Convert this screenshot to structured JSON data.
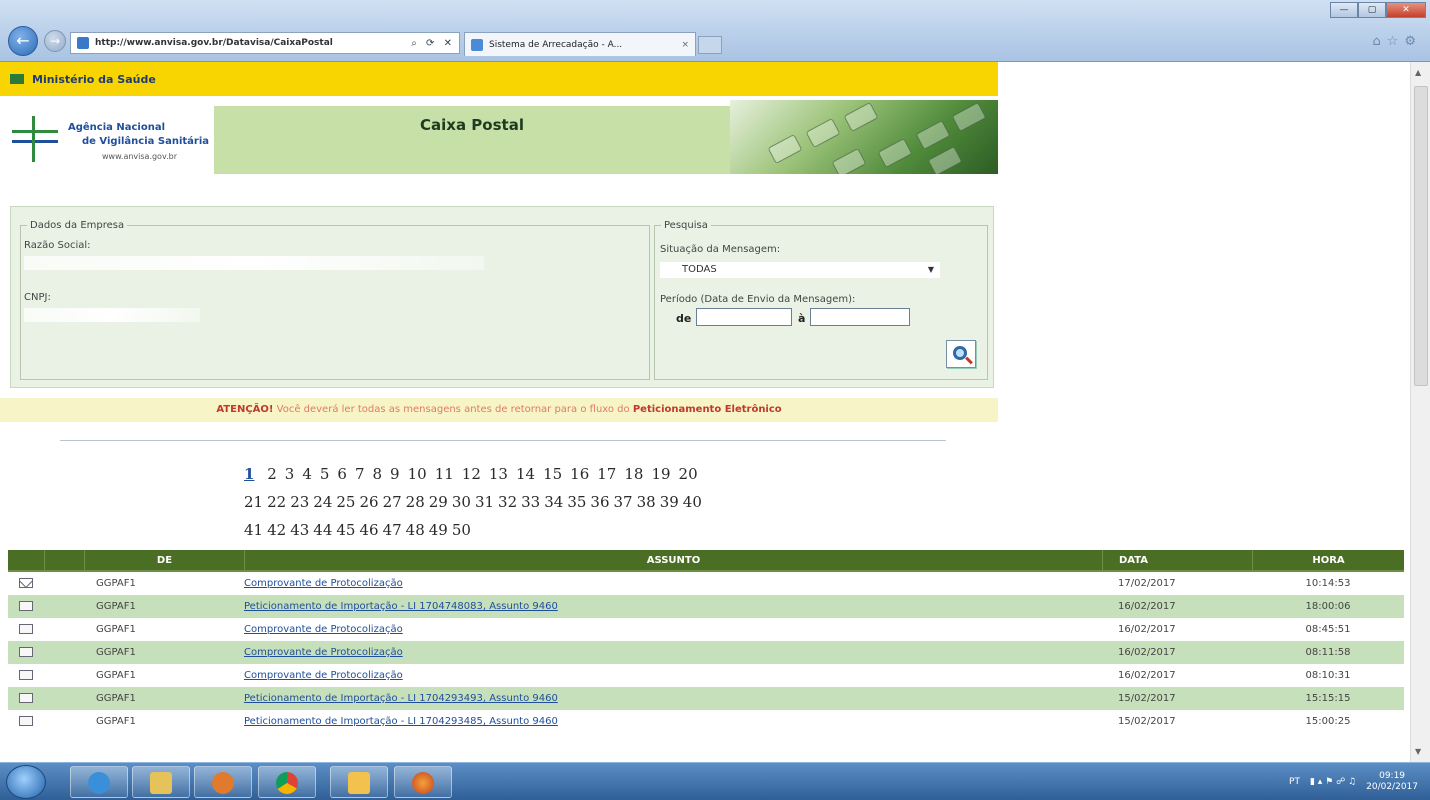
{
  "browser": {
    "address_host": "http://www.anvisa.gov.br/Datavisa/CaixaPostal",
    "tab_title": "Sistema de Arrecadação - A...",
    "tab_close": "×",
    "window_ctrl_min": "—",
    "window_ctrl_max": "▢",
    "window_ctrl_close": "✕",
    "back_glyph": "←",
    "forward_glyph": "→"
  },
  "header": {
    "ministerio": "Ministério da Saúde",
    "agency_line1": "Agência Nacional",
    "agency_line2": "de Vigilância Sanitária",
    "agency_url": "www.anvisa.gov.br",
    "page_title": "Caixa Postal"
  },
  "empresa": {
    "legend": "Dados da Empresa",
    "razao_label": "Razão Social:",
    "cnpj_label": "CNPJ:"
  },
  "pesquisa": {
    "legend": "Pesquisa",
    "situacao_label": "Situação da Mensagem:",
    "situacao_value": "TODAS",
    "periodo_label": "Período (Data de Envio da Mensagem):",
    "de_label": "de",
    "a_label": "à"
  },
  "atencao": {
    "strong": "ATENÇÃO!",
    "text": " Você deverá ler todas as mensagens antes de retornar para o fluxo do ",
    "link": "Peticionamento Eletrônico"
  },
  "pagination": {
    "current": "1",
    "row1": [
      "2",
      "3",
      "4",
      "5",
      "6",
      "7",
      "8",
      "9",
      "10",
      "11",
      "12",
      "13",
      "14",
      "15",
      "16",
      "17",
      "18",
      "19",
      "20"
    ],
    "row2": [
      "21",
      "22",
      "23",
      "24",
      "25",
      "26",
      "27",
      "28",
      "29",
      "30",
      "31",
      "32",
      "33",
      "34",
      "35",
      "36",
      "37",
      "38",
      "39",
      "40"
    ],
    "row3": [
      "41",
      "42",
      "43",
      "44",
      "45",
      "46",
      "47",
      "48",
      "49",
      "50"
    ]
  },
  "table": {
    "headers": {
      "de": "DE",
      "assunto": "ASSUNTO",
      "data": "DATA",
      "hora": "HORA"
    },
    "rows": [
      {
        "de": "GGPAF1",
        "assunto": "Comprovante de Protocolização",
        "data": "17/02/2017",
        "hora": "10:14:53",
        "icon": "envelope-closed"
      },
      {
        "de": "GGPAF1",
        "assunto": "Peticionamento de Importação - LI 1704748083, Assunto 9460",
        "data": "16/02/2017",
        "hora": "18:00:06",
        "icon": "envelope-open"
      },
      {
        "de": "GGPAF1",
        "assunto": "Comprovante de Protocolização",
        "data": "16/02/2017",
        "hora": "08:45:51",
        "icon": "envelope-open"
      },
      {
        "de": "GGPAF1",
        "assunto": "Comprovante de Protocolização",
        "data": "16/02/2017",
        "hora": "08:11:58",
        "icon": "envelope-open"
      },
      {
        "de": "GGPAF1",
        "assunto": "Comprovante de Protocolização",
        "data": "16/02/2017",
        "hora": "08:10:31",
        "icon": "envelope-open"
      },
      {
        "de": "GGPAF1",
        "assunto": "Peticionamento de Importação - LI 1704293493, Assunto 9460",
        "data": "15/02/2017",
        "hora": "15:15:15",
        "icon": "envelope-open"
      },
      {
        "de": "GGPAF1",
        "assunto": "Peticionamento de Importação - LI 1704293485, Assunto 9460",
        "data": "15/02/2017",
        "hora": "15:00:25",
        "icon": "envelope-open"
      }
    ]
  },
  "taskbar": {
    "lang": "PT",
    "time": "09:19",
    "date": "20/02/2017"
  },
  "colors": {
    "ministerio_bar": "#f8d400",
    "table_header": "#4a6e24",
    "row_alt": "#c7e0bc",
    "title_panel": "#c7e0a8"
  }
}
